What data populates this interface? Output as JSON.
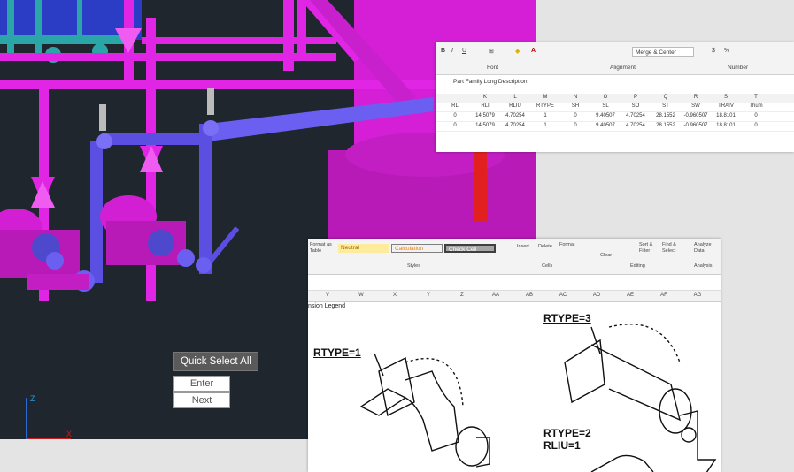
{
  "cad": {
    "quick_select_all": "Quick Select All",
    "enter": "Enter",
    "next": "Next"
  },
  "excel_top": {
    "groups": [
      "Font",
      "Alignment",
      "Number"
    ],
    "merge_center": "Merge & Center",
    "formula_value": "Part Family Long Description",
    "columns": [
      "",
      "K",
      "L",
      "M",
      "N",
      "O",
      "P",
      "Q",
      "R",
      "S",
      "T"
    ],
    "headers": [
      "RL",
      "RLI",
      "RLIU",
      "RTYPE",
      "SH",
      "SL",
      "SO",
      "ST",
      "SW",
      "TRAIV",
      "Thum"
    ],
    "rows": [
      [
        "0",
        "14.5079",
        "4.70254",
        "1",
        "0",
        "9.40507",
        "4.70254",
        "28.1552",
        "-0.960507",
        "18.8101",
        "0"
      ],
      [
        "0",
        "14.5079",
        "4.70254",
        "1",
        "0",
        "9.40507",
        "4.70254",
        "28.1552",
        "-0.960507",
        "18.8101",
        "0"
      ]
    ]
  },
  "excel_bottom": {
    "format_as_table": "Format as Table",
    "styles": [
      "Neutral",
      "Calculation",
      "Check Cell"
    ],
    "styles_group": "Styles",
    "cells_buttons": [
      "Insert",
      "Delete",
      "Format"
    ],
    "cells_group": "Cells",
    "clear": "Clear",
    "sort_filter": "Sort & Filter",
    "find_select": "Find & Select",
    "editing_group": "Editing",
    "analyze_data": "Analyze Data",
    "analysis_group": "Analysis",
    "columns": [
      "V",
      "W",
      "X",
      "Y",
      "Z",
      "AA",
      "AB",
      "AC",
      "AD",
      "AE",
      "AF",
      "AG"
    ],
    "legend_label": "nsion Legend",
    "labels": {
      "rtype1": "RTYPE=1",
      "rtype3": "RTYPE=3",
      "rtype2": "RTYPE=2",
      "rliu1": "RLIU=1"
    }
  }
}
